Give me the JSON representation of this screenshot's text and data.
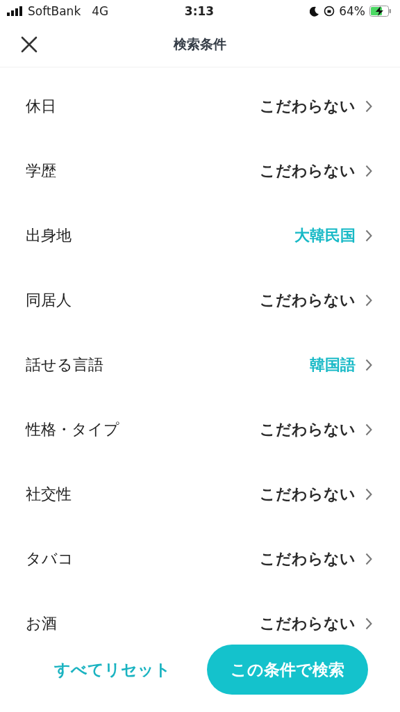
{
  "status_bar": {
    "carrier": "SoftBank",
    "network": "4G",
    "time": "3:13",
    "battery": "64%"
  },
  "header": {
    "title": "検索条件"
  },
  "conditions": [
    {
      "label": "休日",
      "value": "こだわらない",
      "highlighted": false
    },
    {
      "label": "学歴",
      "value": "こだわらない",
      "highlighted": false
    },
    {
      "label": "出身地",
      "value": "大韓民国",
      "highlighted": true
    },
    {
      "label": "同居人",
      "value": "こだわらない",
      "highlighted": false
    },
    {
      "label": "話せる言語",
      "value": "韓国語",
      "highlighted": true
    },
    {
      "label": "性格・タイプ",
      "value": "こだわらない",
      "highlighted": false
    },
    {
      "label": "社交性",
      "value": "こだわらない",
      "highlighted": false
    },
    {
      "label": "タバコ",
      "value": "こだわらない",
      "highlighted": false
    },
    {
      "label": "お酒",
      "value": "こだわらない",
      "highlighted": false
    }
  ],
  "footer": {
    "reset": "すべてリセット",
    "search": "この条件で検索"
  }
}
